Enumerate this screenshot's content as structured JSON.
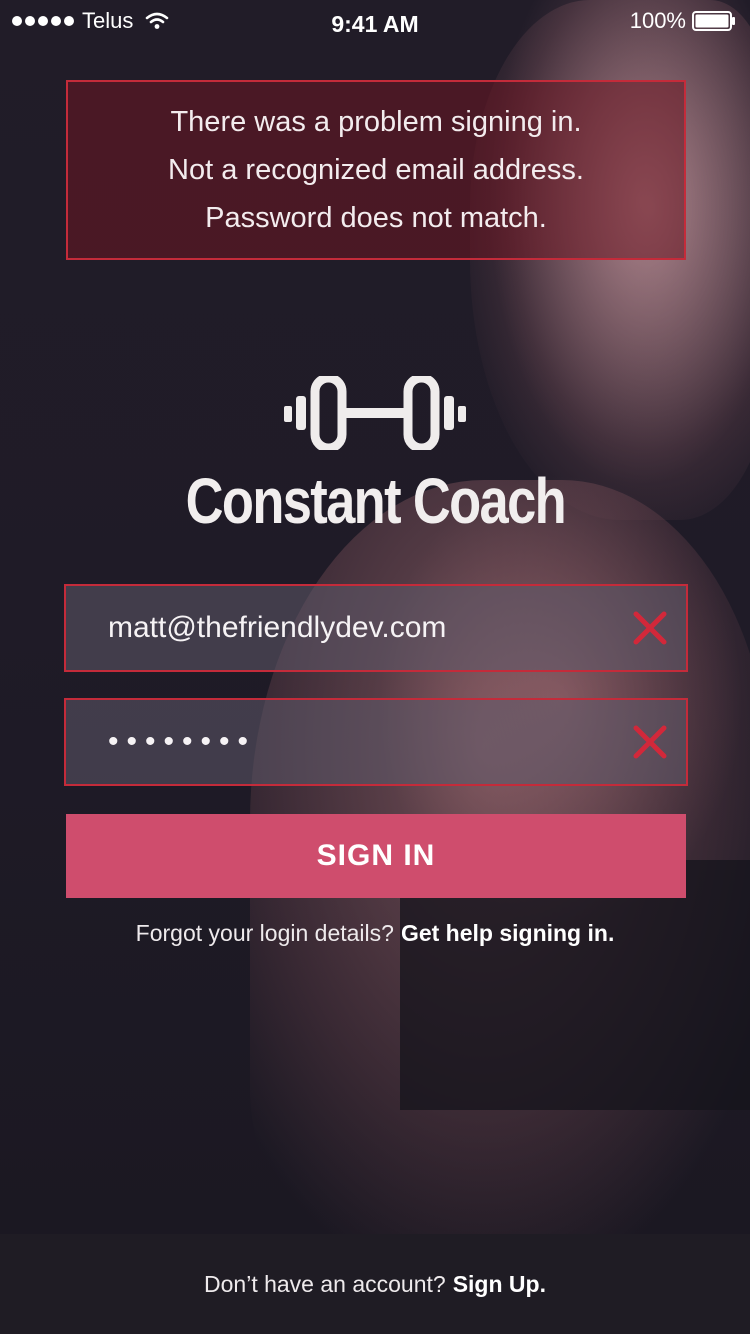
{
  "status_bar": {
    "carrier": "Telus",
    "time": "9:41 AM",
    "battery": "100%",
    "icons": [
      "signal-dots-icon",
      "wifi-icon",
      "battery-icon"
    ]
  },
  "error": {
    "lines": [
      "There was a problem signing in.",
      "Not a recognized email address.",
      "Password does not match."
    ],
    "color": "#c42b3a"
  },
  "brand": {
    "icon": "dumbbell-icon",
    "name": "Constant Coach"
  },
  "form": {
    "email_value": "matt@thefriendlydev.com",
    "password_value": "••••••••",
    "clear_icon": "close-x-icon",
    "sign_in_label": "SIGN IN"
  },
  "help": {
    "prompt": "Forgot your login details?",
    "link": "Get help signing in."
  },
  "footer": {
    "prompt": "Don’t have an account?",
    "link": "Sign Up."
  },
  "colors": {
    "accent": "#cf4d6d",
    "error": "#c42b3a",
    "background": "#1d1a25"
  }
}
